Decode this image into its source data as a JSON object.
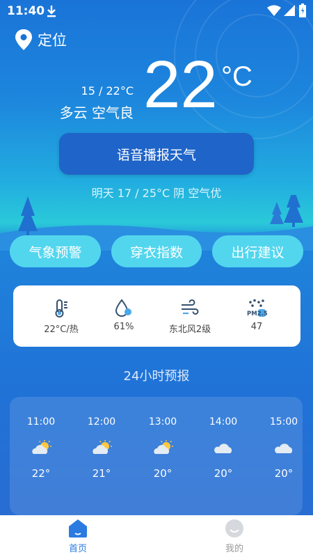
{
  "status_bar": {
    "time": "11:40"
  },
  "location": {
    "label": "定位"
  },
  "current": {
    "temperature": "22",
    "unit": "°C",
    "range": "15 / 22°C",
    "condition": "多云 空气良"
  },
  "voice_button": {
    "label": "语音播报天气"
  },
  "tomorrow": {
    "text": "明天 17 / 25°C 阴 空气优"
  },
  "actions": [
    {
      "label": "气象预警"
    },
    {
      "label": "穿衣指数"
    },
    {
      "label": "出行建议"
    }
  ],
  "metrics": [
    {
      "icon": "thermometer-icon",
      "label": "22°C/热"
    },
    {
      "icon": "humidity-icon",
      "label": "61%"
    },
    {
      "icon": "wind-icon",
      "label": "东北风2级"
    },
    {
      "icon": "pm25-icon",
      "label": "47"
    }
  ],
  "hourly_title": "24小时预报",
  "hourly": [
    {
      "time": "11:00",
      "icon": "partly-cloudy-icon",
      "temp": "22°"
    },
    {
      "time": "12:00",
      "icon": "partly-cloudy-icon",
      "temp": "21°"
    },
    {
      "time": "13:00",
      "icon": "partly-cloudy-icon",
      "temp": "20°"
    },
    {
      "time": "14:00",
      "icon": "cloudy-icon",
      "temp": "20°"
    },
    {
      "time": "15:00",
      "icon": "cloudy-icon",
      "temp": "20°"
    }
  ],
  "bottom_nav": [
    {
      "label": "首页",
      "icon": "home-icon",
      "active": true
    },
    {
      "label": "我的",
      "icon": "profile-icon",
      "active": false
    }
  ],
  "colors": {
    "accent": "#2b7be0",
    "pill": "#52d6ee",
    "voice_button": "#1f64c8"
  }
}
